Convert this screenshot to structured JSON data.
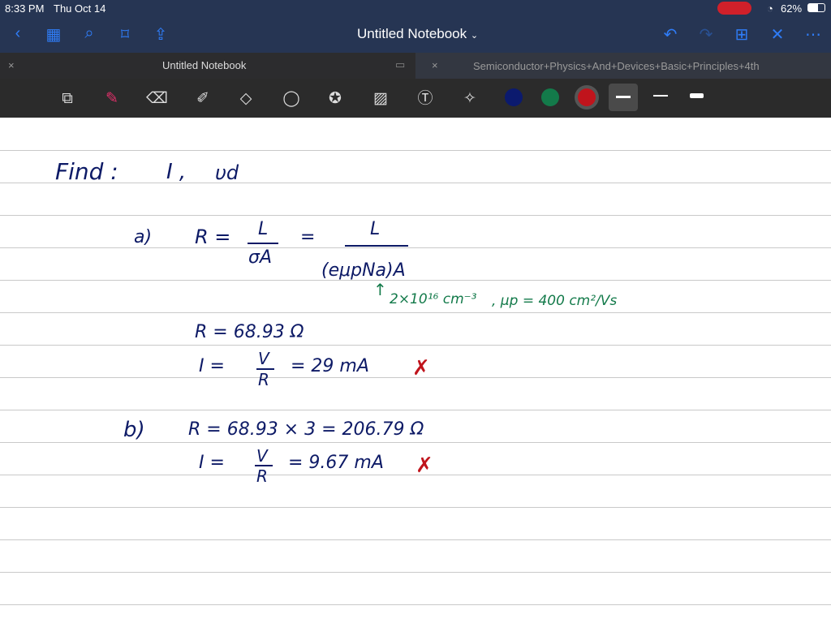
{
  "status": {
    "time": "8:33 PM",
    "date": "Thu Oct 14",
    "battery": "62%"
  },
  "nav": {
    "title": "Untitled Notebook"
  },
  "tabs": [
    {
      "label": "Untitled Notebook"
    },
    {
      "label": "Semiconductor+Physics+And+Devices+Basic+Principles+4th"
    }
  ],
  "colors": {
    "navy": "#0d1a66",
    "green": "#137a4a",
    "red": "#c0141c"
  },
  "notes": {
    "find": "Find :",
    "find_vars": "I ,",
    "vd": "υd",
    "a_label": "a)",
    "a_R": "R =",
    "a_num1": "L",
    "a_den1": "σA",
    "a_eq": "=",
    "a_num2": "L",
    "a_den2": "(eμpNa)A",
    "green_na": "2×10¹⁶ cm⁻³",
    "green_mu": ", μp = 400 cm²/Vs",
    "a_R_val": "R = 68.93 Ω",
    "a_I": "I =",
    "a_V": "V",
    "a_Rd": "R",
    "a_I_val": "= 29 mA",
    "b_label": "b)",
    "b_R": "R = 68.93 × 3 = 206.79 Ω",
    "b_I": "I =",
    "b_V": "V",
    "b_Rd": "R",
    "b_I_val": "= 9.67 mA",
    "check": "✗"
  }
}
